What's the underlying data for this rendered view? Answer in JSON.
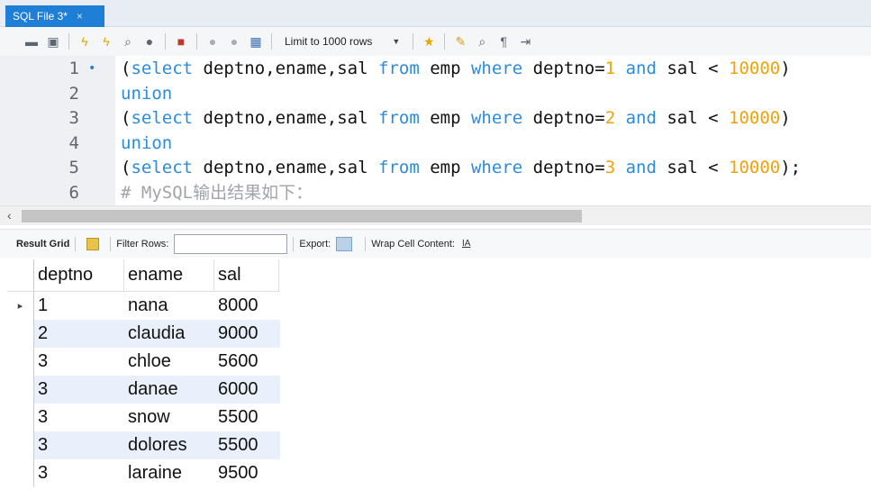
{
  "tab": {
    "title": "SQL File 3*",
    "close": "×"
  },
  "toolbar": {
    "icons_group1": [
      "folder-open-icon",
      "save-icon"
    ],
    "icons_group2": [
      "execute-icon",
      "execute-current-icon",
      "explain-icon",
      "stop-icon"
    ],
    "icons_group3": [
      "toggle-output-icon"
    ],
    "icons_group4": [
      "commit-icon",
      "rollback-icon",
      "autocommit-icon"
    ],
    "limit_label": "Limit to 1000 rows",
    "icons_group5": [
      "add-snippet-icon"
    ],
    "icons_group6": [
      "beautify-icon",
      "find-icon",
      "invisible-chars-icon",
      "wrap-icon"
    ]
  },
  "editor": {
    "lines": [
      {
        "n": "1",
        "dot": "•",
        "parts": [
          [
            "(",
            ""
          ],
          [
            "select",
            "kw"
          ],
          [
            " deptno,ename,sal ",
            ""
          ],
          [
            "from",
            "kw"
          ],
          [
            " emp ",
            ""
          ],
          [
            "where",
            "kw"
          ],
          [
            " deptno=",
            ""
          ],
          [
            "1",
            "num"
          ],
          [
            " ",
            ""
          ],
          [
            "and",
            "kw"
          ],
          [
            " sal < ",
            ""
          ],
          [
            "10000",
            "num"
          ],
          [
            ")",
            ""
          ]
        ]
      },
      {
        "n": "2",
        "dot": "",
        "parts": [
          [
            "union",
            "kw"
          ]
        ]
      },
      {
        "n": "3",
        "dot": "",
        "parts": [
          [
            "(",
            ""
          ],
          [
            "select",
            "kw"
          ],
          [
            " deptno,ename,sal ",
            ""
          ],
          [
            "from",
            "kw"
          ],
          [
            " emp ",
            ""
          ],
          [
            "where",
            "kw"
          ],
          [
            " deptno=",
            ""
          ],
          [
            "2",
            "num"
          ],
          [
            " ",
            ""
          ],
          [
            "and",
            "kw"
          ],
          [
            " sal < ",
            ""
          ],
          [
            "10000",
            "num"
          ],
          [
            ")",
            ""
          ]
        ]
      },
      {
        "n": "4",
        "dot": "",
        "parts": [
          [
            "union",
            "kw"
          ]
        ]
      },
      {
        "n": "5",
        "dot": "",
        "parts": [
          [
            "(",
            ""
          ],
          [
            "select",
            "kw"
          ],
          [
            " deptno,ename,sal ",
            ""
          ],
          [
            "from",
            "kw"
          ],
          [
            " emp ",
            ""
          ],
          [
            "where",
            "kw"
          ],
          [
            " deptno=",
            ""
          ],
          [
            "3",
            "num"
          ],
          [
            " ",
            ""
          ],
          [
            "and",
            "kw"
          ],
          [
            " sal < ",
            ""
          ],
          [
            "10000",
            "num"
          ],
          [
            ");",
            ""
          ]
        ]
      },
      {
        "n": "6",
        "dot": "",
        "parts": [
          [
            "# MySQL输出结果如下：",
            "cmt"
          ]
        ]
      }
    ]
  },
  "results": {
    "result_grid_label": "Result Grid",
    "filter_label": "Filter Rows:",
    "filter_value": "",
    "export_label": "Export:",
    "wrap_label": "Wrap Cell Content:",
    "wrap_icon_glyph": "IA",
    "columns": [
      "deptno",
      "ename",
      "sal"
    ],
    "rows": [
      [
        "1",
        "nana",
        "8000"
      ],
      [
        "2",
        "claudia",
        "9000"
      ],
      [
        "3",
        "chloe",
        "5600"
      ],
      [
        "3",
        "danae",
        "6000"
      ],
      [
        "3",
        "snow",
        "5500"
      ],
      [
        "3",
        "dolores",
        "5500"
      ],
      [
        "3",
        "laraine",
        "9500"
      ]
    ],
    "current_row_marker": "▸"
  },
  "colors": {
    "accent": "#1f7fd6",
    "keyword": "#2a8ce0",
    "number": "#f0a30a",
    "comment": "#a0a4aa",
    "row_alt": "#eaf0fb"
  }
}
